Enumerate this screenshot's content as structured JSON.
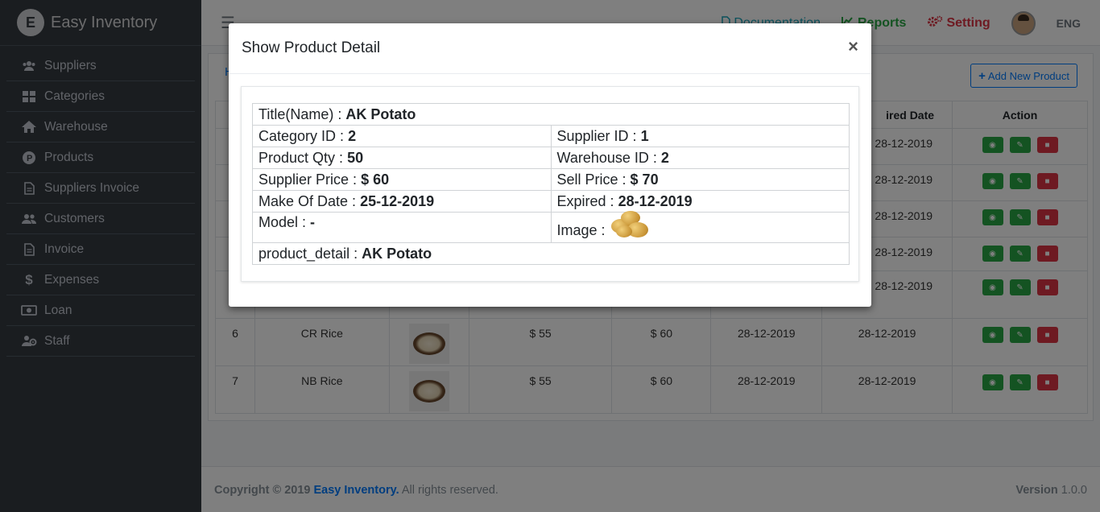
{
  "brand": {
    "initial": "E",
    "name": "Easy Inventory"
  },
  "sidebar": {
    "items": [
      {
        "label": "Suppliers",
        "icon": "users-icon"
      },
      {
        "label": "Categories",
        "icon": "grid-icon"
      },
      {
        "label": "Warehouse",
        "icon": "home-icon"
      },
      {
        "label": "Products",
        "icon": "product-icon"
      },
      {
        "label": "Suppliers Invoice",
        "icon": "file-icon"
      },
      {
        "label": "Customers",
        "icon": "users-icon"
      },
      {
        "label": "Invoice",
        "icon": "file-icon"
      },
      {
        "label": "Expenses",
        "icon": "dollar-icon"
      },
      {
        "label": "Loan",
        "icon": "money-icon"
      },
      {
        "label": "Staff",
        "icon": "staff-icon"
      }
    ]
  },
  "topbar": {
    "documentation": "Documentation",
    "reports": "Reports",
    "setting": "Setting",
    "lang": "ENG"
  },
  "page": {
    "crumb": "H",
    "add_button": "Add New Product",
    "table": {
      "headers": [
        "",
        "",
        "",
        "",
        "",
        "",
        "ired Date",
        "Action"
      ],
      "rows_hidden": [
        {
          "date2": "28-12-2019"
        },
        {
          "date2": "28-12-2019"
        },
        {
          "date2": "28-12-2019"
        },
        {
          "date2": "28-12-2019"
        },
        {
          "date2": "28-12-2019"
        }
      ],
      "rows": [
        {
          "id": "6",
          "name": "CR Rice",
          "supplier_price": "$ 55",
          "sell_price": "$ 60",
          "date1": "28-12-2019",
          "date2": "28-12-2019"
        },
        {
          "id": "7",
          "name": "NB Rice",
          "supplier_price": "$ 55",
          "sell_price": "$ 60",
          "date1": "28-12-2019",
          "date2": "28-12-2019"
        }
      ]
    }
  },
  "footer": {
    "copyright_prefix": "Copyright © 2019",
    "brand": "Easy Inventory.",
    "rights": "All rights reserved.",
    "version_label": "Version",
    "version": "1.0.0"
  },
  "modal": {
    "title": "Show Product Detail",
    "close": "×",
    "fields": {
      "title_label": "Title(Name) :",
      "title_value": "AK Potato",
      "category_label": "Category ID :",
      "category_value": "2",
      "supplier_label": "Supplier ID :",
      "supplier_value": "1",
      "qty_label": "Product Qty :",
      "qty_value": "50",
      "warehouse_label": "Warehouse ID :",
      "warehouse_value": "2",
      "supplier_price_label": "Supplier Price :",
      "supplier_price_value": "$ 60",
      "sell_price_label": "Sell Price :",
      "sell_price_value": "$ 70",
      "make_label": "Make Of Date :",
      "make_value": "25-12-2019",
      "expired_label": "Expired :",
      "expired_value": "28-12-2019",
      "model_label": "Model :",
      "model_value": "-",
      "image_label": "Image :",
      "detail_label": "product_detail :",
      "detail_value": "AK Potato"
    }
  },
  "colors": {
    "sidebar": "#343a40",
    "primary": "#007bff",
    "success": "#28a745",
    "danger": "#dc3545",
    "info": "#17a2b8"
  }
}
